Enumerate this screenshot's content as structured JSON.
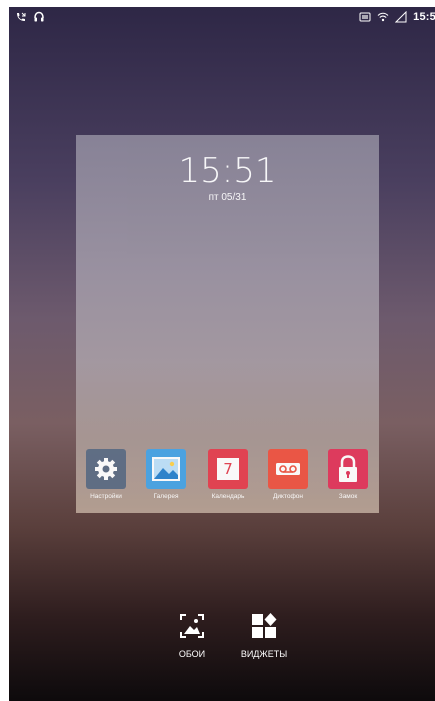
{
  "status_bar": {
    "time": "15:5",
    "left_icons": [
      "call-missed-icon",
      "headset-icon"
    ],
    "right_icons": [
      "screenshot-icon",
      "wifi-icon",
      "signal-icon"
    ]
  },
  "preview": {
    "clock_time": "15:51",
    "date": "пт  05/31",
    "apps": [
      {
        "label": "Настройки",
        "icon": "settings-icon",
        "color": "#5f6f86"
      },
      {
        "label": "Галерея",
        "icon": "gallery-icon",
        "color": "#4aa6e6"
      },
      {
        "label": "Календарь",
        "icon": "calendar-icon",
        "color": "#e54352",
        "glyph": "7"
      },
      {
        "label": "Диктофон",
        "icon": "voice-recorder-icon",
        "color": "#ef5745"
      },
      {
        "label": "Замок",
        "icon": "lock-icon",
        "color": "#e23a5e"
      }
    ]
  },
  "actions": [
    {
      "label": "ОБОИ",
      "icon": "wallpaper-icon"
    },
    {
      "label": "ВИДЖЕТЫ",
      "icon": "widgets-icon"
    }
  ]
}
